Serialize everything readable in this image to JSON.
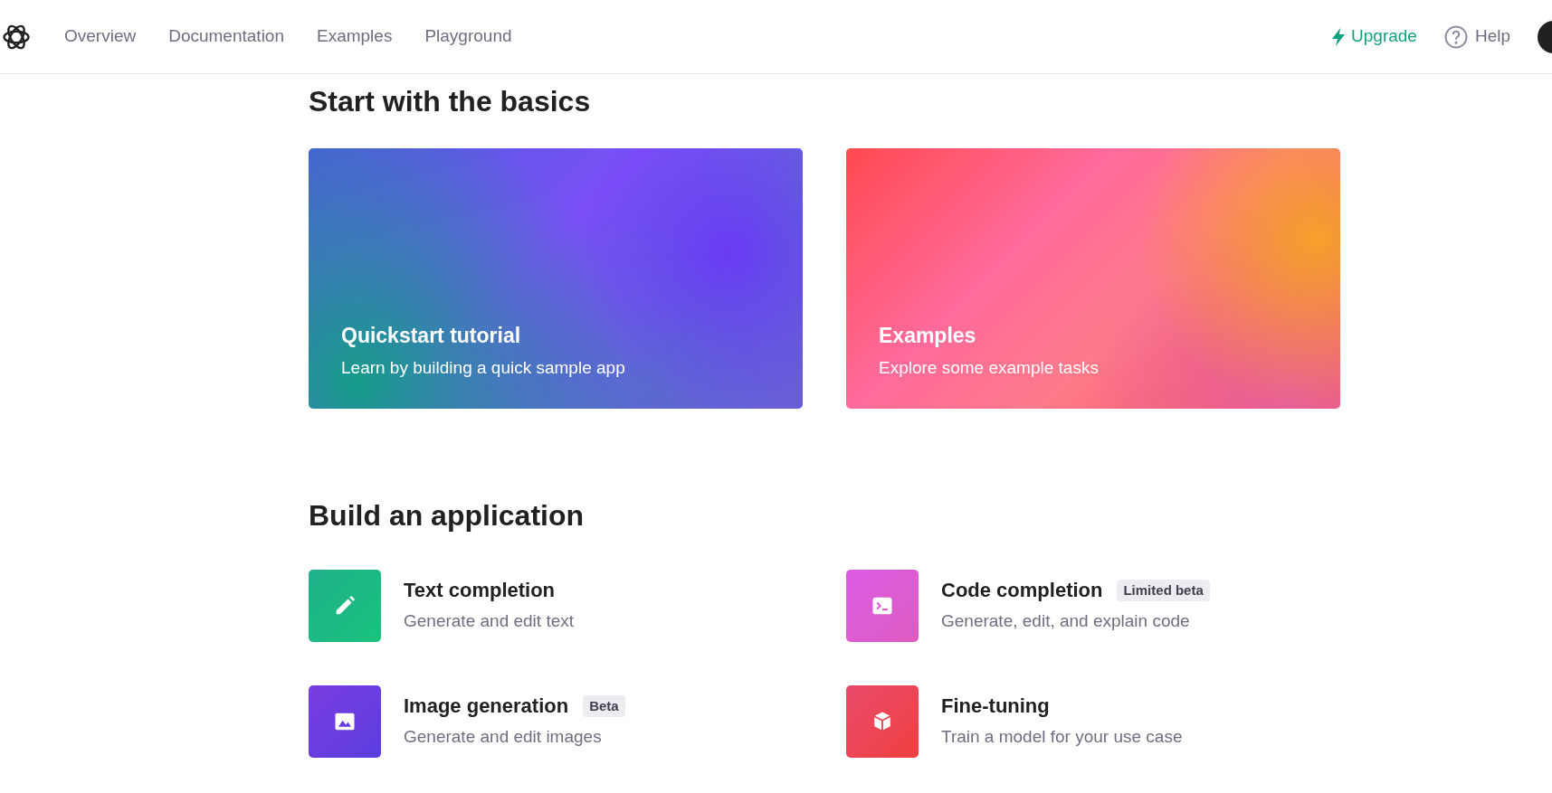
{
  "nav": {
    "links": [
      {
        "label": "Overview"
      },
      {
        "label": "Documentation"
      },
      {
        "label": "Examples"
      },
      {
        "label": "Playground"
      }
    ],
    "upgrade": "Upgrade",
    "help": "Help"
  },
  "basics": {
    "heading": "Start with the basics",
    "cards": [
      {
        "title": "Quickstart tutorial",
        "subtitle": "Learn by building a quick sample app"
      },
      {
        "title": "Examples",
        "subtitle": "Explore some example tasks"
      }
    ]
  },
  "build": {
    "heading": "Build an application",
    "items": [
      {
        "kind": "pencil",
        "title": "Text completion",
        "subtitle": "Generate and edit text"
      },
      {
        "kind": "terminal",
        "title": "Code completion",
        "badge": "Limited beta",
        "subtitle": "Generate, edit, and explain code"
      },
      {
        "kind": "image",
        "title": "Image generation",
        "badge": "Beta",
        "subtitle": "Generate and edit images"
      },
      {
        "kind": "cube",
        "title": "Fine-tuning",
        "subtitle": "Train a model for your use case"
      }
    ]
  }
}
